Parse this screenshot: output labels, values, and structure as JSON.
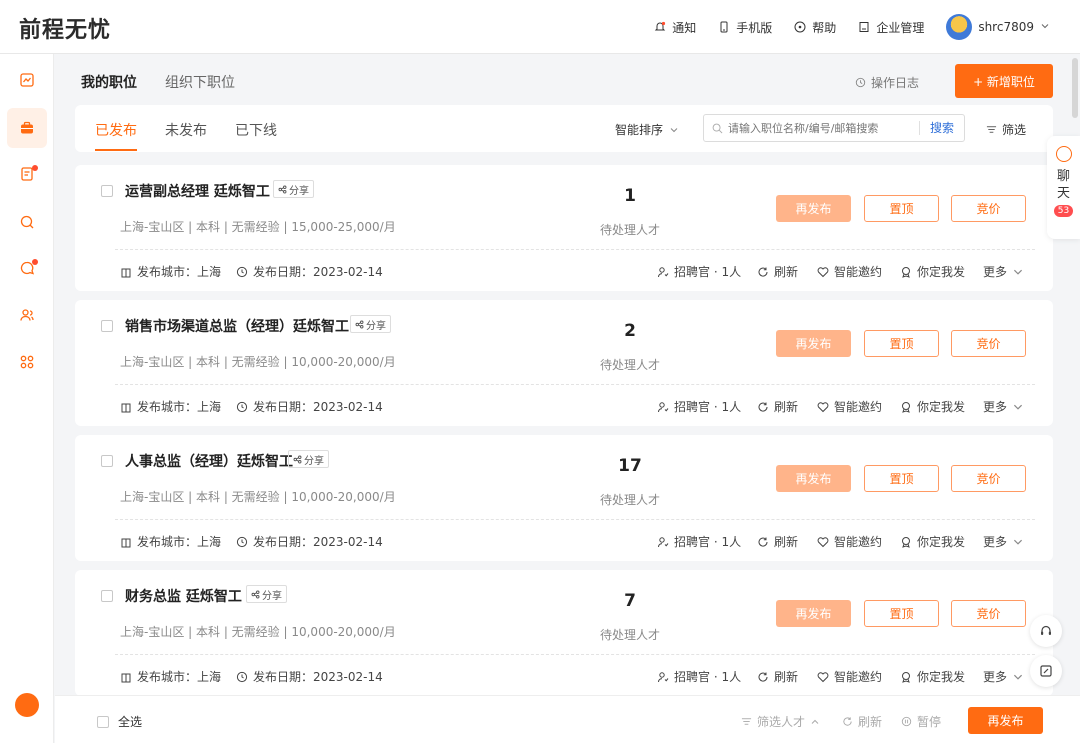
{
  "header": {
    "logo": "前程无忧",
    "nav": [
      {
        "label": "通知",
        "icon": "bell-icon"
      },
      {
        "label": "手机版",
        "icon": "phone-icon"
      },
      {
        "label": "帮助",
        "icon": "help-icon"
      },
      {
        "label": "企业管理",
        "icon": "building-icon"
      }
    ],
    "username": "shrc7809"
  },
  "sidebar": {
    "items": [
      {
        "icon": "chart-icon"
      },
      {
        "icon": "briefcase-icon",
        "active": true
      },
      {
        "icon": "resume-icon",
        "dot": true
      },
      {
        "icon": "search-talent-icon"
      },
      {
        "icon": "message-icon",
        "dot": true
      },
      {
        "icon": "users-icon"
      },
      {
        "icon": "apps-icon"
      }
    ]
  },
  "page_tabs": [
    "我的职位",
    "组织下职位"
  ],
  "operation_log": "操作日志",
  "new_job_button": "+ 新增职位",
  "status_tabs": [
    "已发布",
    "未发布",
    "已下线"
  ],
  "sort_label": "智能排序",
  "search": {
    "placeholder": "请输入职位名称/编号/邮箱搜索",
    "button": "搜索"
  },
  "filter_label": "筛选",
  "job_actions": {
    "republish": "再发布",
    "pin": "置顶",
    "bid": "竞价",
    "share": "分享",
    "pending_label": "待处理人才",
    "recruiter": "招聘官 · 1人",
    "refresh": "刷新",
    "smart_invite": "智能邀约",
    "you_decide": "你定我发",
    "more": "更多"
  },
  "jobs": [
    {
      "title": "运营副总经理 廷烁智工",
      "meta": "上海-宝山区 | 本科 | 无需经验 | 15,000-25,000/月",
      "pending": "1",
      "city": "发布城市：上海",
      "date": "发布日期：2023-02-14"
    },
    {
      "title": "销售市场渠道总监（经理）廷烁智工",
      "meta": "上海-宝山区 | 本科 | 无需经验 | 10,000-20,000/月",
      "pending": "2",
      "city": "发布城市：上海",
      "date": "发布日期：2023-02-14"
    },
    {
      "title": "人事总监（经理）廷烁智工",
      "meta": "上海-宝山区 | 本科 | 无需经验 | 10,000-20,000/月",
      "pending": "17",
      "city": "发布城市：上海",
      "date": "发布日期：2023-02-14"
    },
    {
      "title": "财务总监 廷烁智工",
      "meta": "上海-宝山区 | 本科 | 无需经验 | 10,000-20,000/月",
      "pending": "7",
      "city": "发布城市：上海",
      "date": "发布日期：2023-02-14"
    }
  ],
  "chat": {
    "label_1": "聊",
    "label_2": "天",
    "badge": "53"
  },
  "bottom": {
    "select_all": "全选",
    "filter_talent": "筛选人才",
    "refresh": "刷新",
    "pause": "暂停",
    "republish": "再发布"
  },
  "colors": {
    "accent": "#ff6b12",
    "accent_light": "#ffb48a",
    "link": "#2f6fd8"
  }
}
